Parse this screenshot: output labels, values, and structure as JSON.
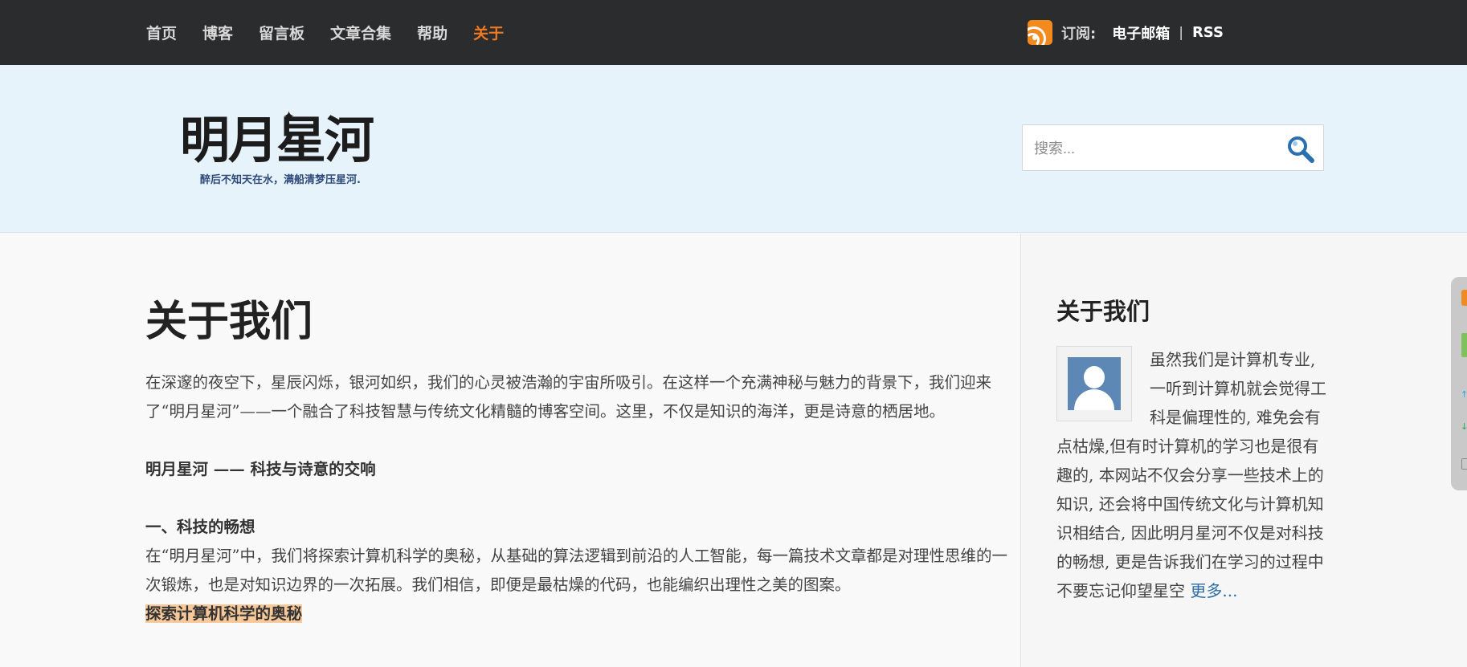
{
  "nav": {
    "items": [
      {
        "label": "首页"
      },
      {
        "label": "博客"
      },
      {
        "label": "留言板"
      },
      {
        "label": "文章合集"
      },
      {
        "label": "帮助"
      },
      {
        "label": "关于",
        "active": true
      }
    ],
    "active_color": "#f07a22"
  },
  "subscribe": {
    "icon": "rss-icon",
    "label": "订阅:",
    "email_label": "电子邮箱",
    "separator": "|",
    "rss_label": "RSS"
  },
  "header": {
    "logo_title": "明月星河",
    "logo_subtitle": "醉后不知天在水，满船清梦压星河.",
    "search_placeholder": "搜索...",
    "search_icon": "search-icon"
  },
  "main": {
    "title": "关于我们",
    "intro": "在深邃的夜空下，星辰闪烁，银河如织，我们的心灵被浩瀚的宇宙所吸引。在这样一个充满神秘与魅力的背景下，我们迎来了“明月星河”——一个融合了科技智慧与传统文化精髓的博客空间。这里，不仅是知识的海洋，更是诗意的栖居地。",
    "subtitle": "明月星河 —— 科技与诗意的交响",
    "section1_title": "一、科技的畅想",
    "section1_text": "在“明月星河”中，我们将探索计算机科学的奥秘，从基础的算法逻辑到前沿的人工智能，每一篇技术文章都是对理性思维的一次锻炼，也是对知识边界的一次拓展。我们相信，即便是最枯燥的代码，也能编织出理性之美的图案。",
    "highlight_text": "探索计算机科学的奥秘"
  },
  "sidebar": {
    "title": "关于我们",
    "avatar_icon": "user-avatar-icon",
    "text": "虽然我们是计算机专业, 一听到计算机就会觉得工科是偏理性的, 难免会有点枯燥,但有时计算机的学习也是很有趣的, 本网站不仅会分享一些技术上的知识, 还会将中国传统文化与计算机知识相结合, 因此明月星河不仅是对科技的畅想, 更是告诉我们在学习的过程中不要忘记仰望星空",
    "more_link": "更多..."
  },
  "colors": {
    "topbar": "#2b2c2e",
    "header_bg": "#e7f3fb",
    "accent": "#f07a22",
    "link": "#2f6ea5",
    "highlight": "#f6c89a"
  }
}
